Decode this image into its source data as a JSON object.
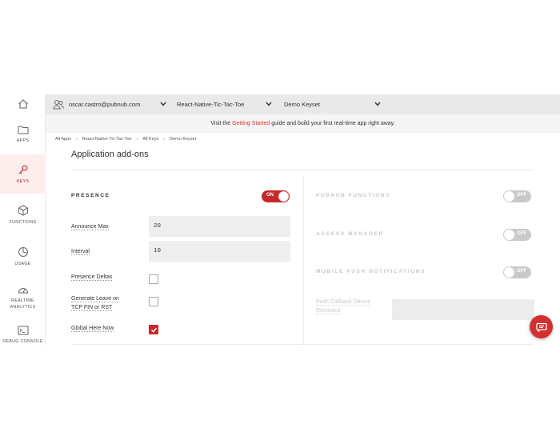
{
  "sidebar": {
    "home": "",
    "items": [
      {
        "label": "APPS",
        "icon": "folder-icon"
      },
      {
        "label": "KEYS",
        "icon": "key-icon",
        "active": true
      },
      {
        "label": "FUNCTIONS",
        "icon": "cube-icon"
      },
      {
        "label": "USAGE",
        "icon": "pie-chart-icon"
      },
      {
        "label": "REALTIME",
        "label2": "ANALYTICS",
        "icon": "gauge-icon"
      },
      {
        "label": "DEBUG CONSOLE",
        "icon": "terminal-icon"
      }
    ]
  },
  "topbar": {
    "account": "oscar.castro@pubnub.com",
    "app": "React-Native-Tic-Tac-Toe",
    "keyset": "Demo Keyset"
  },
  "infobar": {
    "before": "Visit the",
    "link": "Getting Started",
    "after": "guide and build your first real-time app right away."
  },
  "breadcrumb": [
    "All Apps",
    "React-Native-Tic-Tac-Toe",
    "All Keys",
    "Demo Keyset"
  ],
  "page_title": "Application add-ons",
  "presence": {
    "title": "PRESENCE",
    "toggle": "ON",
    "announce_max_label": "Announce Max",
    "announce_max_value": "20",
    "interval_label": "Interval",
    "interval_value": "10",
    "deltas_label": "Presence Deltas",
    "generate_leave_label_1": "Generate Leave on",
    "generate_leave_label_2": "TCP FIN or RST",
    "global_here_now_label": "Global Here Now",
    "deltas_checked": false,
    "generate_leave_checked": false,
    "global_here_now_checked": true
  },
  "right": {
    "functions_title": "PUBNUB FUNCTIONS",
    "functions_toggle": "OFF",
    "access_title": "ACCESS MANAGER",
    "access_toggle": "OFF",
    "push_title": "MOBILE PUSH NOTIFICATIONS",
    "push_toggle": "OFF",
    "push_callback_label_1": "Push Callback Device",
    "push_callback_label_2": "Removed"
  },
  "colors": {
    "accent": "#c62828",
    "link": "#e2312a"
  }
}
